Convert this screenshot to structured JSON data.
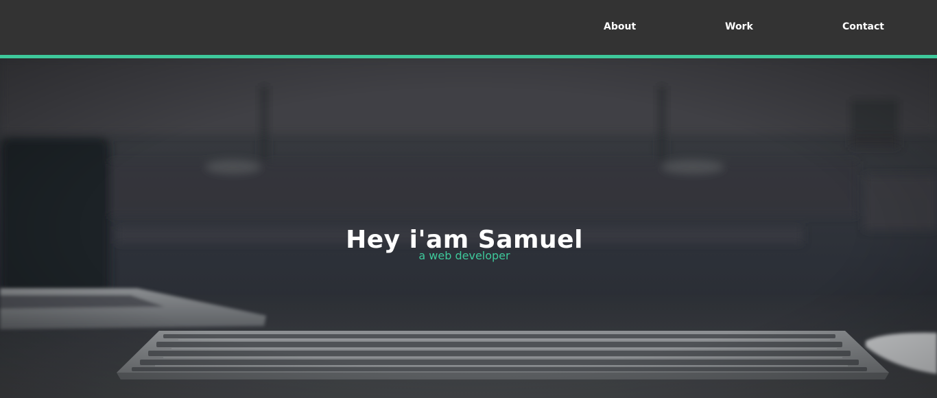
{
  "nav": {
    "links": [
      "About",
      "Work",
      "Contact"
    ]
  },
  "hero": {
    "title": "Hey i'am Samuel",
    "subtitle": "a web developer"
  },
  "colors": {
    "navbar_bg": "#333333",
    "accent": "#3ec99b",
    "hero_text": "#ffffff"
  }
}
